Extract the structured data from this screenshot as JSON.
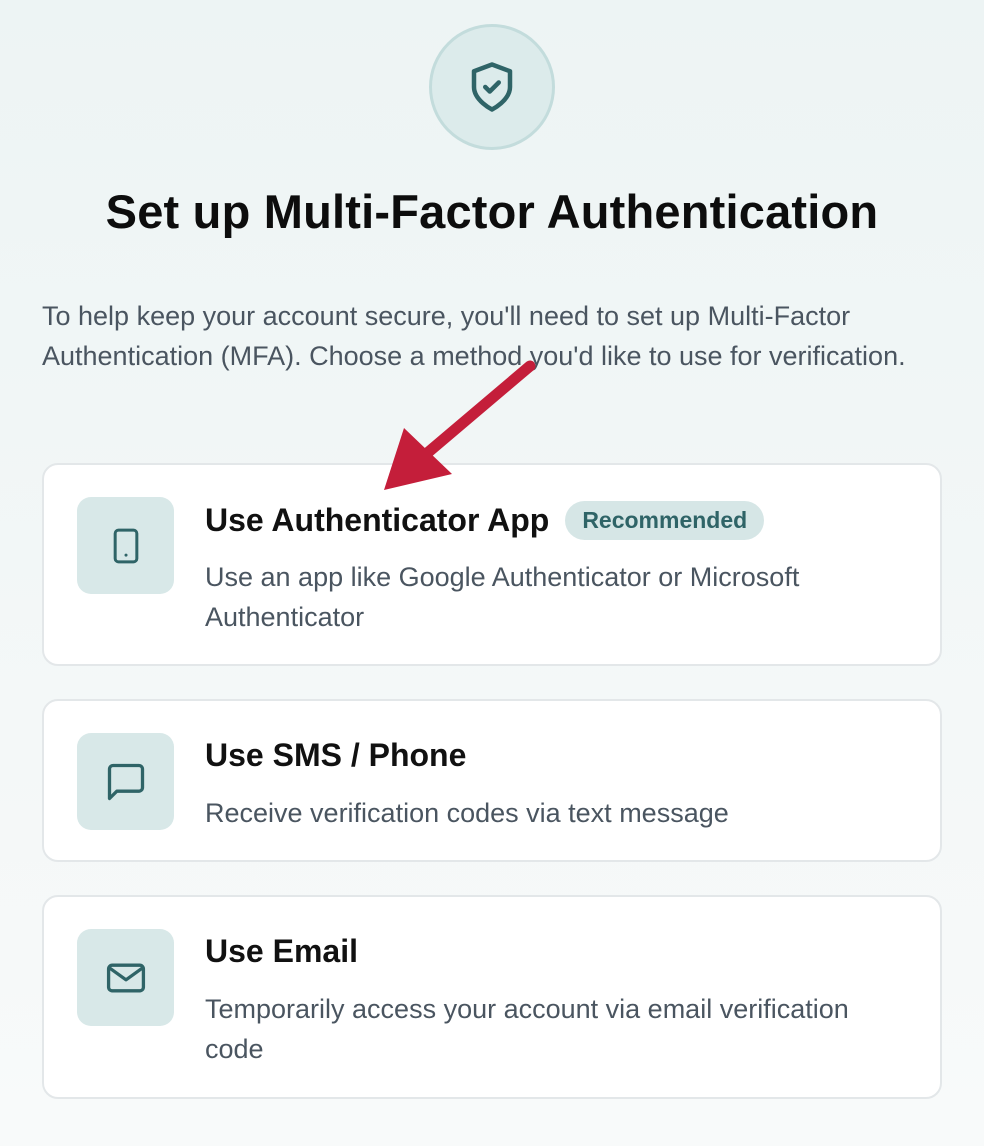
{
  "header": {
    "icon": "shield-check-icon",
    "title": "Set up Multi-Factor Authentication",
    "description": "To help keep your account secure, you'll need to set up Multi-Factor Authentication (MFA). Choose a method you'd like to use for verification."
  },
  "options": [
    {
      "icon": "smartphone-icon",
      "title": "Use Authenticator App",
      "badge": "Recommended",
      "description": "Use an app like Google Authenticator or Microsoft Authenticator"
    },
    {
      "icon": "message-square-icon",
      "title": "Use SMS / Phone",
      "description": "Receive verification codes via text message"
    },
    {
      "icon": "mail-icon",
      "title": "Use Email",
      "description": "Temporarily access your account via email verification code"
    }
  ],
  "annotation": {
    "icon": "arrow-annotation",
    "color": "#c41e3a"
  },
  "colors": {
    "accent": "#2f6467",
    "icon_bg": "#d8e8e8"
  }
}
